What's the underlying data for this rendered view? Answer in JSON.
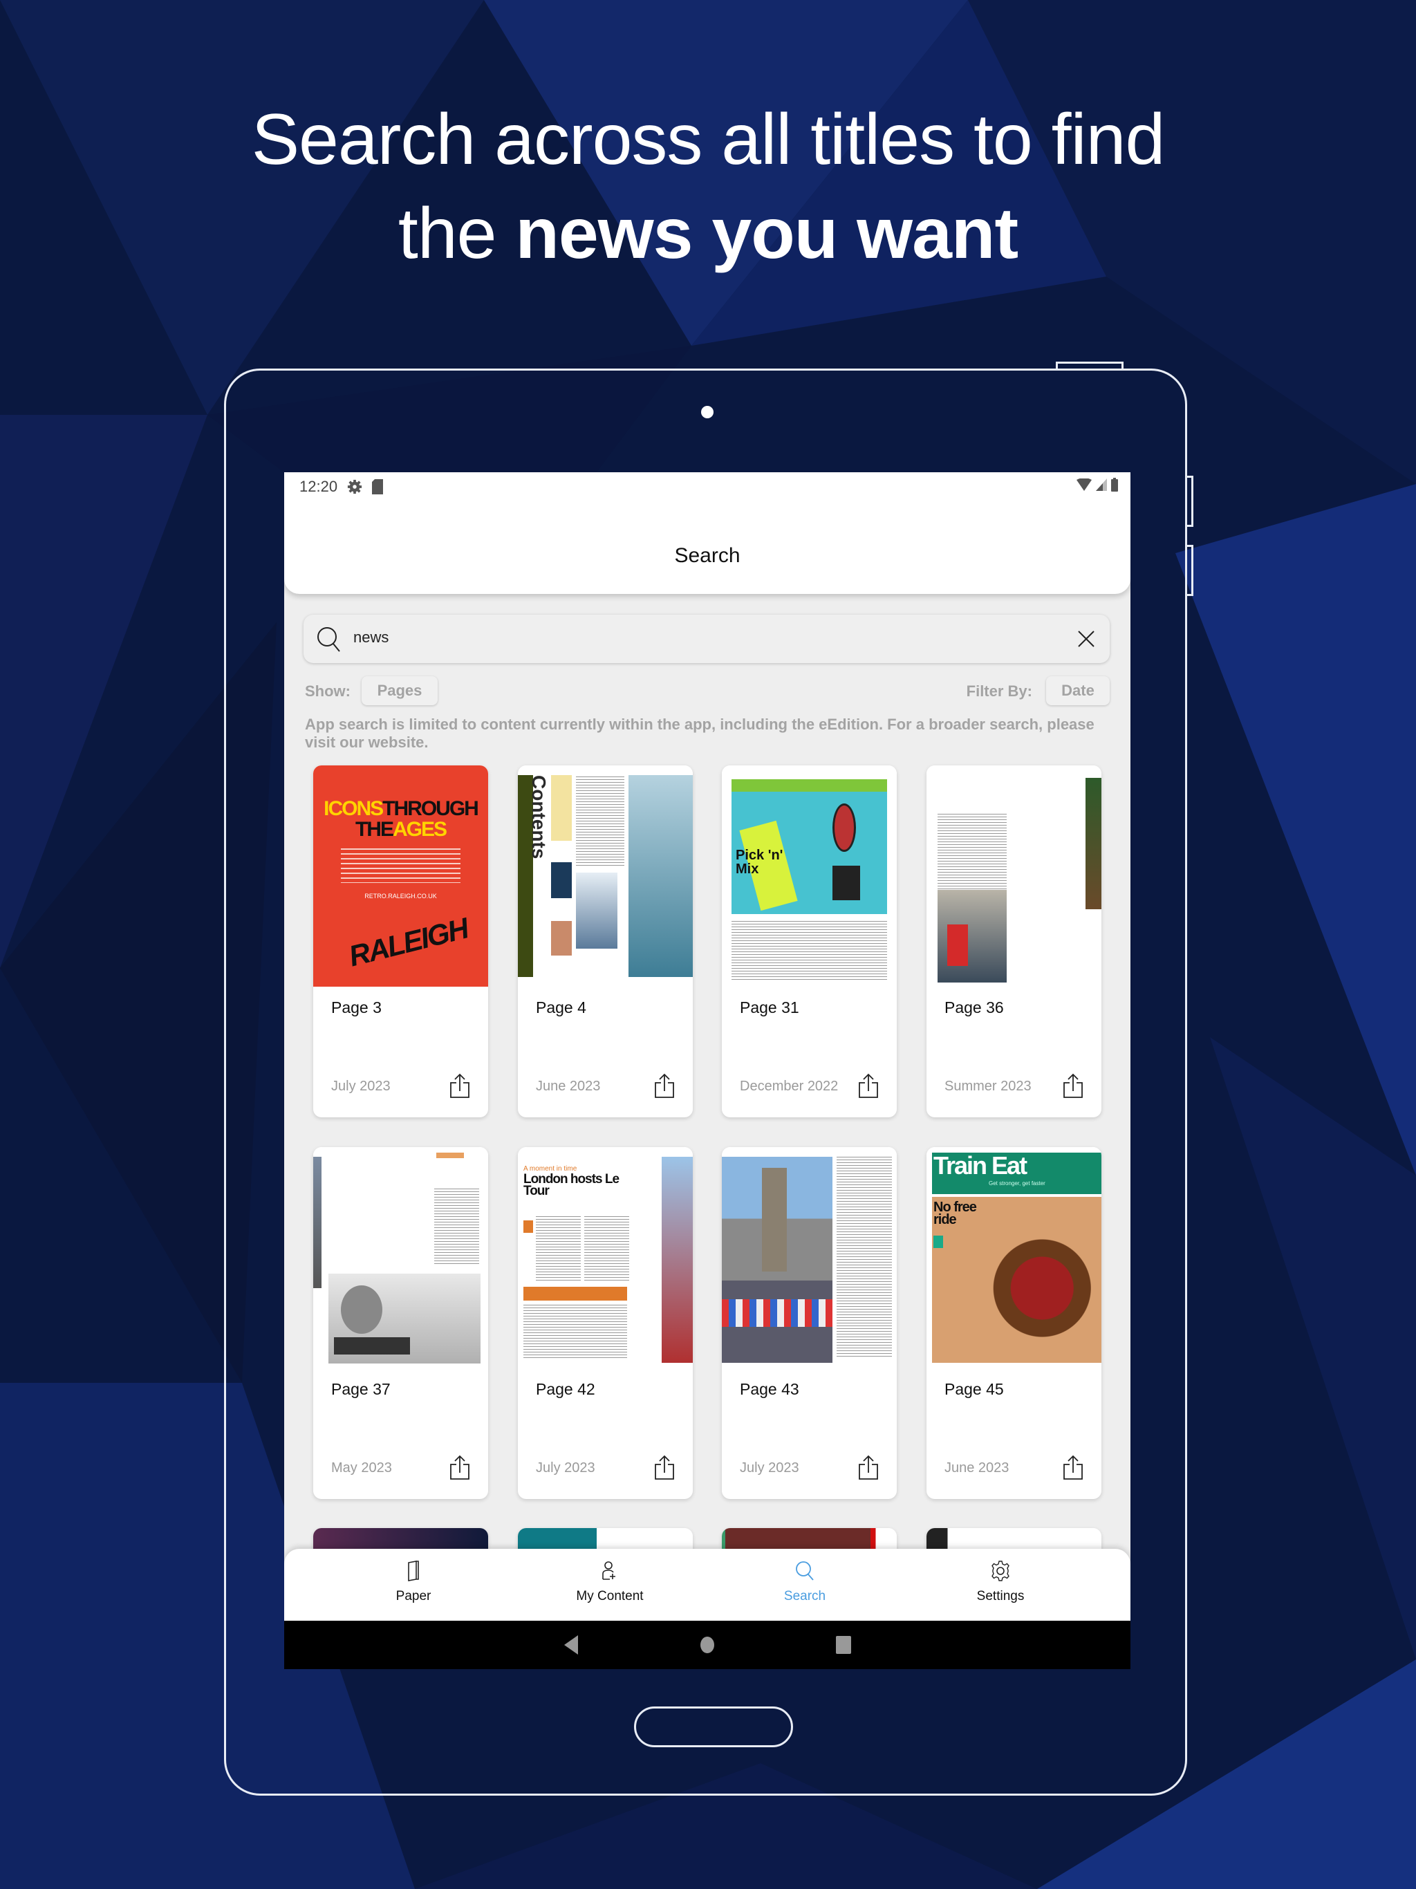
{
  "headline": {
    "line1": "Search across all titles to find",
    "line2_pre": "the ",
    "line2_bold": "news you want"
  },
  "status_bar": {
    "time": "12:20"
  },
  "header": {
    "title": "Search"
  },
  "search": {
    "value": "news",
    "placeholder": ""
  },
  "filters": {
    "show_label": "Show:",
    "show_value": "Pages",
    "filter_label": "Filter By:",
    "filter_value": "Date"
  },
  "info_text": "App search is limited to content currently within the app, including the eEdition. For a broader search, please visit our website.",
  "results": [
    {
      "page": "Page 3",
      "date": "July 2023",
      "thumb": {
        "kind": "raleigh",
        "t1": "ICONS",
        "t2": "THROUGH",
        "t3": "THE",
        "t4": "AGES",
        "t5": "RETRO.RALEIGH.CO.UK",
        "logo": "RALEIGH"
      }
    },
    {
      "page": "Page 4",
      "date": "June 2023",
      "thumb": {
        "kind": "contents",
        "t1": "Contents"
      }
    },
    {
      "page": "Page 31",
      "date": "December 2022",
      "thumb": {
        "kind": "pick",
        "t1": "Pick 'n' Mix"
      }
    },
    {
      "page": "Page 36",
      "date": "Summer 2023",
      "thumb": {
        "kind": "race"
      }
    },
    {
      "page": "Page 37",
      "date": "May 2023",
      "thumb": {
        "kind": "snow"
      }
    },
    {
      "page": "Page 42",
      "date": "July 2023",
      "thumb": {
        "kind": "london",
        "t1": "A moment in time",
        "t2": "London hosts Le Tour"
      }
    },
    {
      "page": "Page 43",
      "date": "July 2023",
      "thumb": {
        "kind": "bridge"
      }
    },
    {
      "page": "Page 45",
      "date": "June 2023",
      "thumb": {
        "kind": "train",
        "t1": "Train",
        "t2": "Eat",
        "t3": "Get stronger, get faster",
        "t4": "No free ride"
      }
    }
  ],
  "bottom_nav": [
    {
      "label": "Paper",
      "icon": "paper-icon",
      "active": false
    },
    {
      "label": "My Content",
      "icon": "add-user-icon",
      "active": false
    },
    {
      "label": "Search",
      "icon": "search-icon",
      "active": true
    },
    {
      "label": "Settings",
      "icon": "gear-icon",
      "active": false
    }
  ],
  "colors": {
    "accent": "#4a9de0",
    "background": "#0b1a45",
    "raleigh_red": "#e8412c"
  }
}
